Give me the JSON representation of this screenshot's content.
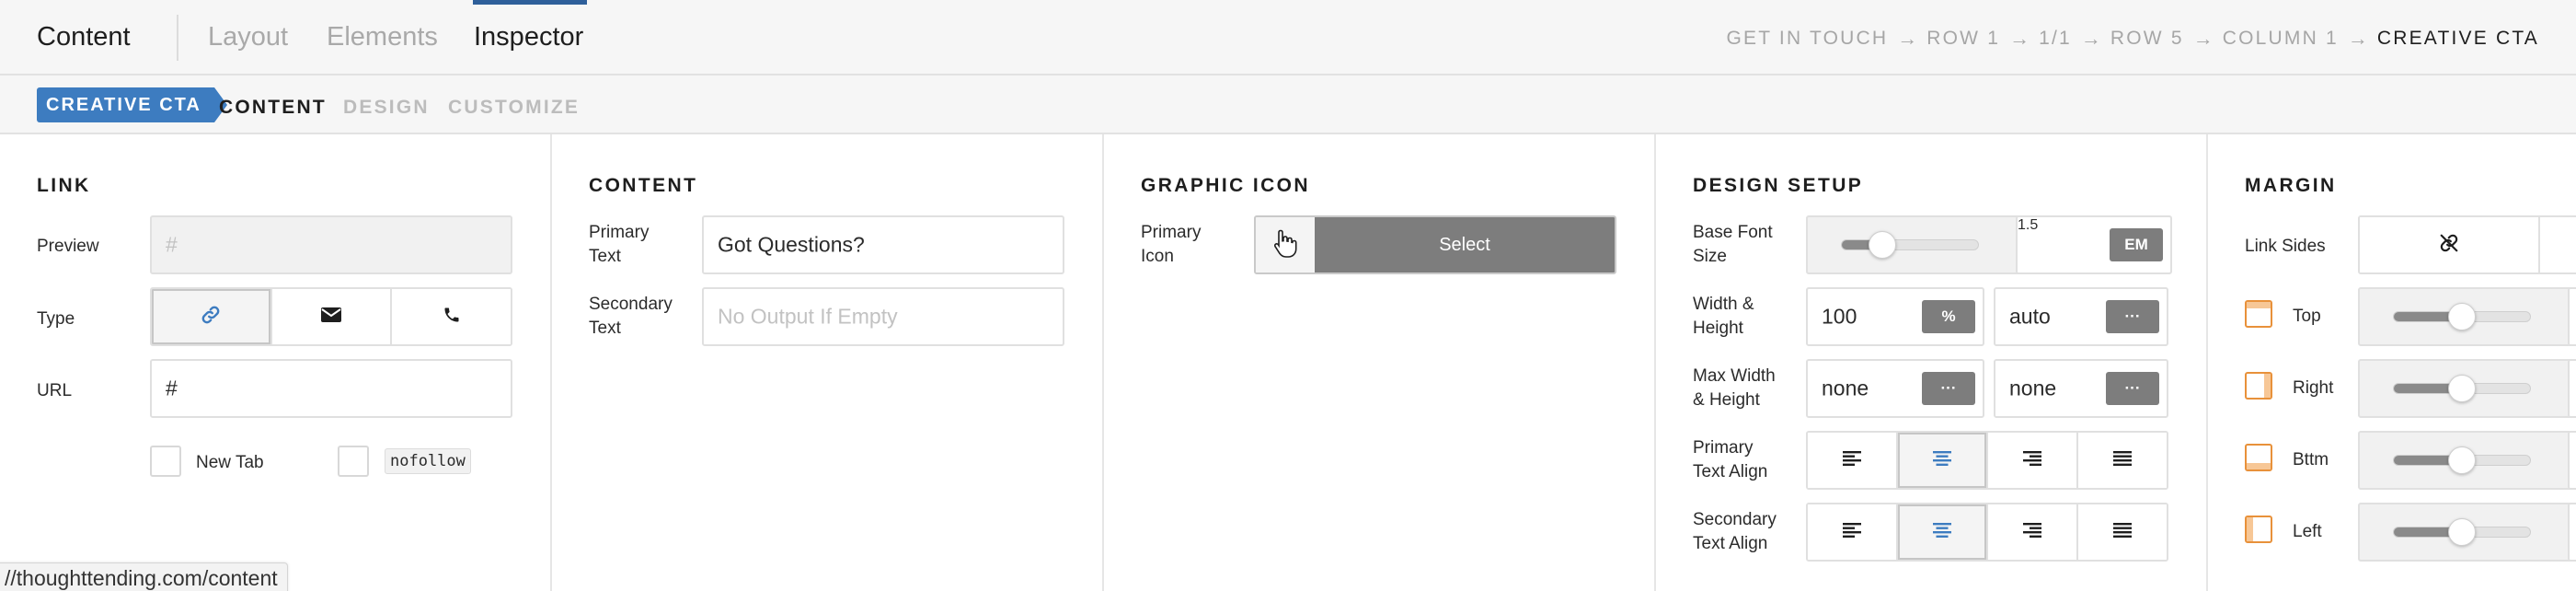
{
  "topbar": {
    "tabs": [
      "Content",
      "Layout",
      "Elements",
      "Inspector"
    ],
    "active_tab": "Inspector",
    "breadcrumb": [
      "GET IN TOUCH",
      "ROW 1",
      "1/1",
      "ROW 5",
      "COLUMN 1",
      "CREATIVE CTA"
    ],
    "arrow": "→"
  },
  "subbar": {
    "element_badge": "CREATIVE CTA",
    "tabs": [
      "CONTENT",
      "DESIGN",
      "CUSTOMIZE"
    ],
    "active_tab": "CONTENT",
    "badge_color": "#3d7cc0"
  },
  "link_panel": {
    "title": "LINK",
    "preview_label": "Preview",
    "preview_placeholder": "#",
    "type_label": "Type",
    "type_options": [
      "link-icon",
      "envelope-icon",
      "phone-icon"
    ],
    "type_selected": "link-icon",
    "url_label": "URL",
    "url_value": "#",
    "new_tab_label": "New Tab",
    "nofollow_label": "nofollow"
  },
  "content_panel": {
    "title": "CONTENT",
    "primary_label": [
      "Primary",
      "Text"
    ],
    "primary_value": "Got Questions?",
    "secondary_label": [
      "Secondary",
      "Text"
    ],
    "secondary_placeholder": "No Output If Empty"
  },
  "graphic_panel": {
    "title": "GRAPHIC ICON",
    "primary_icon_label": [
      "Primary",
      "Icon"
    ],
    "select_label": "Select"
  },
  "design_panel": {
    "title": "DESIGN SETUP",
    "base_font_label": [
      "Base Font",
      "Size"
    ],
    "base_font_value": "1.5",
    "base_font_unit": "EM",
    "width_height_label": [
      "Width &",
      "Height"
    ],
    "width_value": "100",
    "width_unit": "%",
    "height_value": "auto",
    "height_unit": "···",
    "max_wh_label": [
      "Max Width",
      "& Height"
    ],
    "max_width_value": "none",
    "max_width_unit": "···",
    "max_height_value": "none",
    "max_height_unit": "···",
    "primary_align_label": [
      "Primary",
      "Text Align"
    ],
    "primary_align_selected": "center",
    "secondary_align_label": [
      "Secondary",
      "Text Align"
    ],
    "secondary_align_selected": "center"
  },
  "margin_panel": {
    "title": "MARGIN",
    "link_sides_label": "Link Sides",
    "sides": [
      "Top",
      "Right",
      "Bttm",
      "Left"
    ]
  },
  "status_url": "//thoughttending.com/content",
  "colors": {
    "accent": "#3d7cc0",
    "active_line": "#2e5f9a",
    "side_icon": "#e8913a"
  }
}
